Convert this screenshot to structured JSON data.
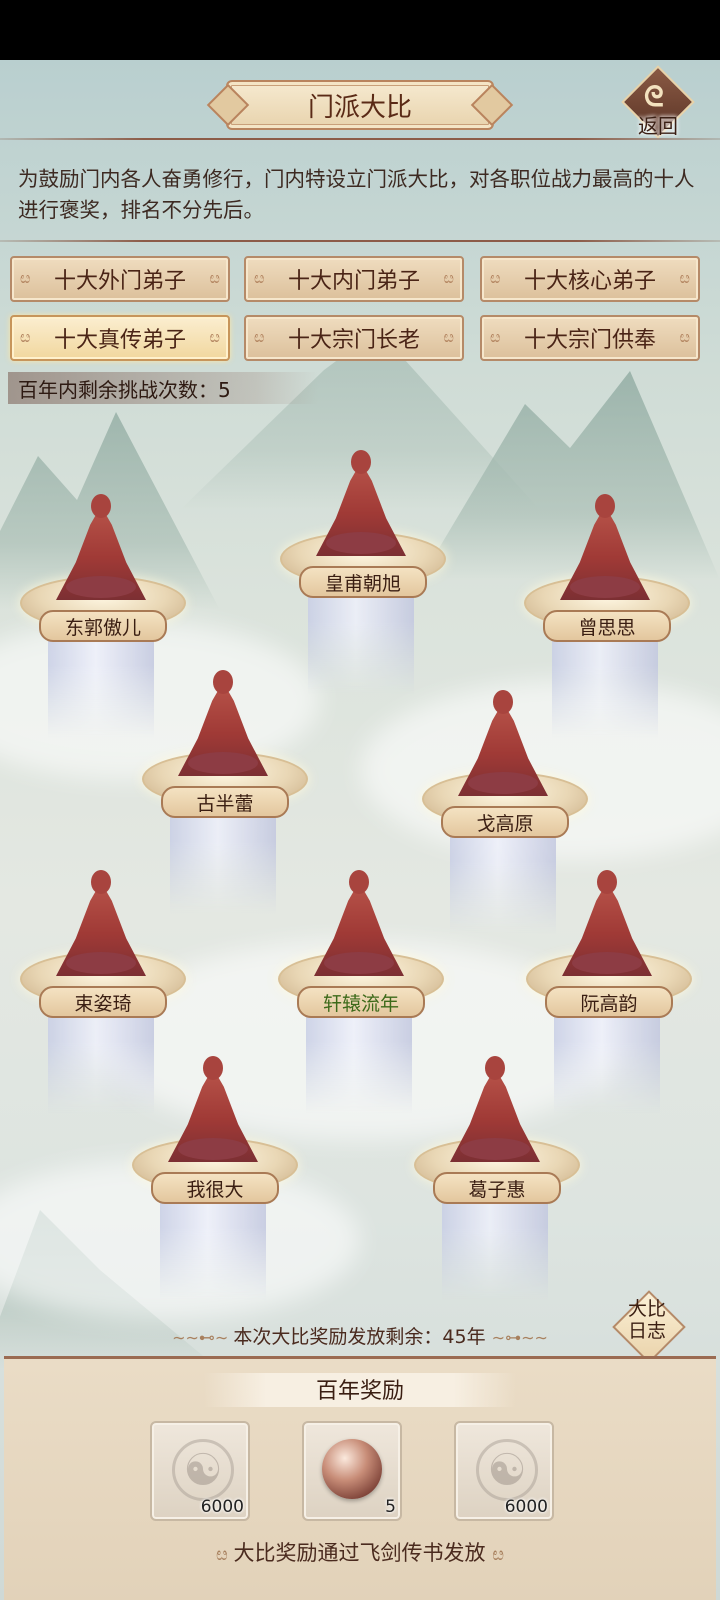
{
  "header": {
    "title": "门派大比",
    "back_label": "返回"
  },
  "intro": "为鼓励门内各人奋勇修行，门内特设立门派大比，对各职位战力最高的十人进行褒奖，排名不分先后。",
  "tabs": [
    {
      "label": "十大外门弟子",
      "active": false
    },
    {
      "label": "十大内门弟子",
      "active": false
    },
    {
      "label": "十大核心弟子",
      "active": false
    },
    {
      "label": "十大真传弟子",
      "active": true
    },
    {
      "label": "十大宗门长老",
      "active": false
    },
    {
      "label": "十大宗门供奉",
      "active": false
    }
  ],
  "challenges": "百年内剩余挑战次数：5",
  "seats": [
    {
      "name": "东郭傲儿"
    },
    {
      "name": "皇甫朝旭"
    },
    {
      "name": "曾思思"
    },
    {
      "name": "古半蕾"
    },
    {
      "name": "戈高原"
    },
    {
      "name": "束姿琦"
    },
    {
      "name": "轩辕流年",
      "highlight": true
    },
    {
      "name": "阮高韵"
    },
    {
      "name": "我很大"
    },
    {
      "name": "葛子惠"
    }
  ],
  "log_button": {
    "line1": "大比",
    "line2": "日志"
  },
  "reward_remaining": "本次大比奖励发放剩余：45年",
  "rewards": {
    "title": "百年奖励",
    "items": [
      {
        "icon": "yin-yang-icon",
        "qty": "6000"
      },
      {
        "icon": "orb-icon",
        "qty": "5"
      },
      {
        "icon": "yin-yang-icon",
        "qty": "6000"
      }
    ],
    "note": "大比奖励通过飞剑传书发放"
  },
  "colors": {
    "accent": "#8c5c48",
    "highlight_name": "#3d6a1a"
  }
}
